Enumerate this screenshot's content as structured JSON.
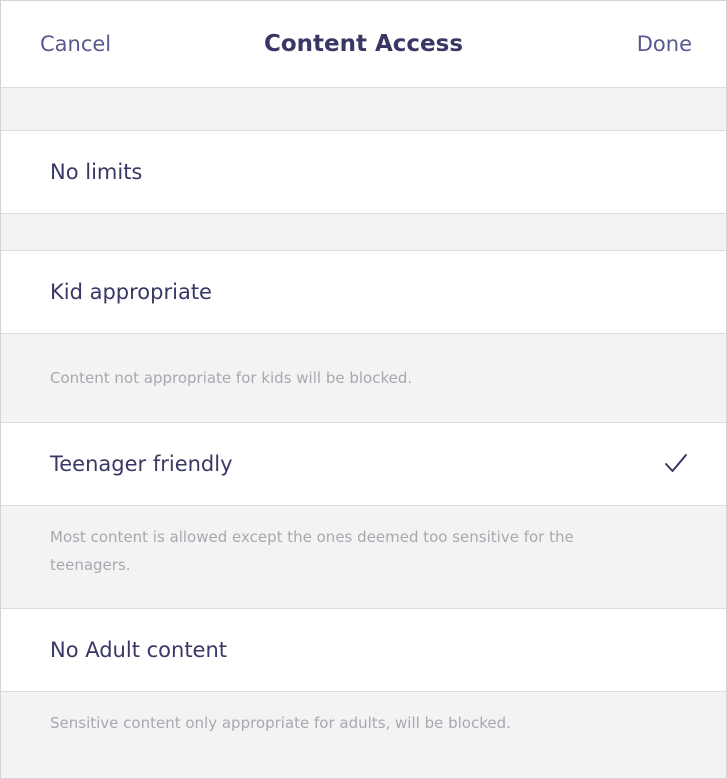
{
  "nav": {
    "cancel_label": "Cancel",
    "title": "Content Access",
    "done_label": "Done"
  },
  "options": [
    {
      "label": "No limits",
      "selected": false,
      "footer": ""
    },
    {
      "label": "Kid appropriate",
      "selected": false,
      "footer": "Content not appropriate for kids will be blocked."
    },
    {
      "label": "Teenager friendly",
      "selected": true,
      "footer": "Most content is allowed except the ones deemed too sensitive for the teenagers."
    },
    {
      "label": "No Adult content",
      "selected": false,
      "footer": "Sensitive content only appropriate for adults, will be blocked."
    }
  ],
  "icons": {
    "selected_marker": "checkmark-icon"
  },
  "colors": {
    "accent": "#59598f",
    "title": "#393865",
    "footer_text": "#a8a8b0",
    "background": "#f3f3f4"
  }
}
